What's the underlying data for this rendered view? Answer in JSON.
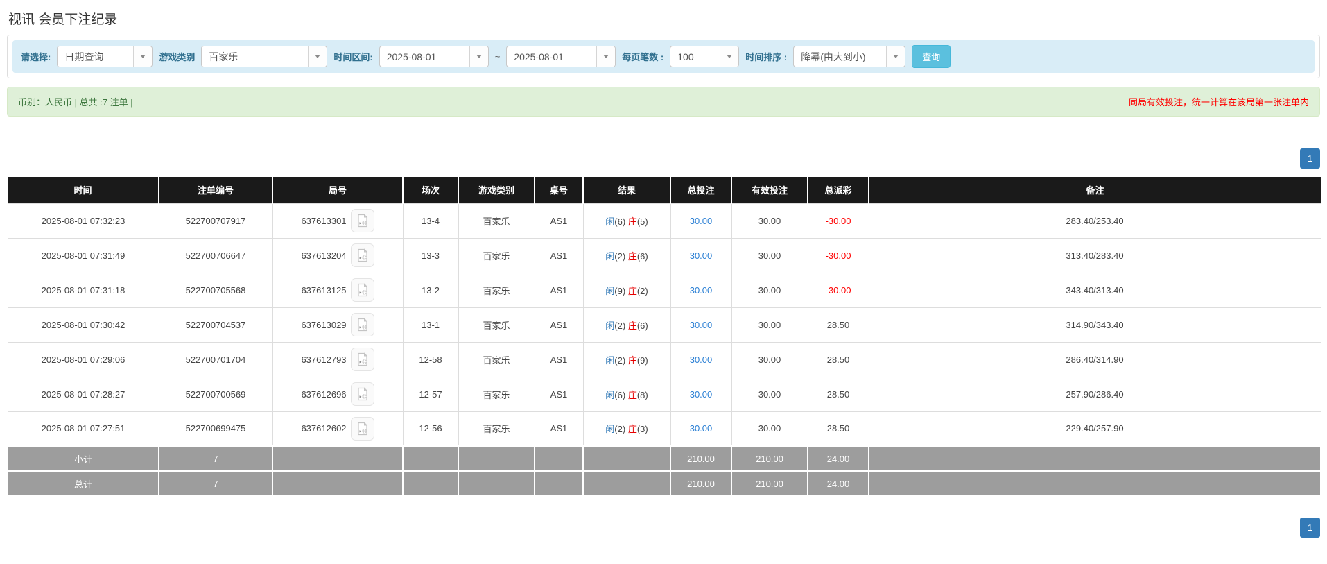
{
  "page": {
    "title": "视讯 会员下注纪录"
  },
  "colors": {
    "accent_blue": "#337ab7",
    "search_button": "#5bc0de",
    "filter_bar_bg": "#d9edf7",
    "summary_bg": "#dff0d8",
    "summary_text": "#3c763d",
    "warning_red": "#ff0000",
    "header_black": "#1a1a1a",
    "sum_row_gray": "#9d9d9d"
  },
  "filters": {
    "select_label": "请选择:",
    "select_value": "日期查询",
    "game_type_label": "游戏类别",
    "game_type_value": "百家乐",
    "time_range_label": "时间区间:",
    "date_from": "2025-08-01",
    "range_separator": "~",
    "date_to": "2025-08-01",
    "page_size_label": "每页笔数 :",
    "page_size_value": "100",
    "sort_label": "时间排序 :",
    "sort_value": "降幂(由大到小)",
    "search_button": "查询"
  },
  "summary": {
    "left": "币别：人民币 | 总共 :7 注单 |",
    "right": "同局有效投注，统一计算在该局第一张注单内"
  },
  "pagination": {
    "page": "1"
  },
  "table": {
    "headers": [
      "时间",
      "注单编号",
      "局号",
      "场次",
      "游戏类别",
      "桌号",
      "结果",
      "总投注",
      "有效投注",
      "总派彩",
      "备注"
    ],
    "rows": [
      {
        "time": "2025-08-01 07:32:23",
        "bet_id": "522700707917",
        "round_id": "637613301",
        "session": "13-4",
        "game": "百家乐",
        "table_no": "AS1",
        "result": {
          "player": "闲",
          "player_n": "(6)",
          "banker": "庄",
          "banker_n": "(5)"
        },
        "total_bet": "30.00",
        "valid_bet": "30.00",
        "payout": "-30.00",
        "remark": "283.40/253.40"
      },
      {
        "time": "2025-08-01 07:31:49",
        "bet_id": "522700706647",
        "round_id": "637613204",
        "session": "13-3",
        "game": "百家乐",
        "table_no": "AS1",
        "result": {
          "player": "闲",
          "player_n": "(2)",
          "banker": "庄",
          "banker_n": "(6)"
        },
        "total_bet": "30.00",
        "valid_bet": "30.00",
        "payout": "-30.00",
        "remark": "313.40/283.40"
      },
      {
        "time": "2025-08-01 07:31:18",
        "bet_id": "522700705568",
        "round_id": "637613125",
        "session": "13-2",
        "game": "百家乐",
        "table_no": "AS1",
        "result": {
          "player": "闲",
          "player_n": "(9)",
          "banker": "庄",
          "banker_n": "(2)"
        },
        "total_bet": "30.00",
        "valid_bet": "30.00",
        "payout": "-30.00",
        "remark": "343.40/313.40"
      },
      {
        "time": "2025-08-01 07:30:42",
        "bet_id": "522700704537",
        "round_id": "637613029",
        "session": "13-1",
        "game": "百家乐",
        "table_no": "AS1",
        "result": {
          "player": "闲",
          "player_n": "(2)",
          "banker": "庄",
          "banker_n": "(6)"
        },
        "total_bet": "30.00",
        "valid_bet": "30.00",
        "payout": "28.50",
        "remark": "314.90/343.40"
      },
      {
        "time": "2025-08-01 07:29:06",
        "bet_id": "522700701704",
        "round_id": "637612793",
        "session": "12-58",
        "game": "百家乐",
        "table_no": "AS1",
        "result": {
          "player": "闲",
          "player_n": "(2)",
          "banker": "庄",
          "banker_n": "(9)"
        },
        "total_bet": "30.00",
        "valid_bet": "30.00",
        "payout": "28.50",
        "remark": "286.40/314.90"
      },
      {
        "time": "2025-08-01 07:28:27",
        "bet_id": "522700700569",
        "round_id": "637612696",
        "session": "12-57",
        "game": "百家乐",
        "table_no": "AS1",
        "result": {
          "player": "闲",
          "player_n": "(6)",
          "banker": "庄",
          "banker_n": "(8)"
        },
        "total_bet": "30.00",
        "valid_bet": "30.00",
        "payout": "28.50",
        "remark": "257.90/286.40"
      },
      {
        "time": "2025-08-01 07:27:51",
        "bet_id": "522700699475",
        "round_id": "637612602",
        "session": "12-56",
        "game": "百家乐",
        "table_no": "AS1",
        "result": {
          "player": "闲",
          "player_n": "(2)",
          "banker": "庄",
          "banker_n": "(3)"
        },
        "total_bet": "30.00",
        "valid_bet": "30.00",
        "payout": "28.50",
        "remark": "229.40/257.90"
      }
    ],
    "subtotal": {
      "label": "小计",
      "count": "7",
      "total_bet": "210.00",
      "valid_bet": "210.00",
      "payout": "24.00"
    },
    "total": {
      "label": "总计",
      "count": "7",
      "total_bet": "210.00",
      "valid_bet": "210.00",
      "payout": "24.00"
    }
  }
}
